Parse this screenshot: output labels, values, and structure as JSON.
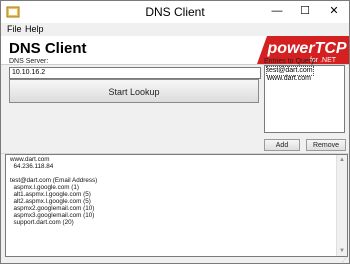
{
  "window": {
    "title": "DNS Client",
    "minimize": "—",
    "maximize": "☐",
    "close": "✕"
  },
  "menu": {
    "file": "File",
    "help": "Help"
  },
  "header": {
    "title": "DNS Client",
    "logo_main": "powerTCP",
    "logo_sub": "for .NET"
  },
  "server": {
    "label": "DNS Server:",
    "value": "10.10.16.2"
  },
  "lookup_button": "Start Lookup",
  "queries": {
    "label": "Entries to Query:",
    "items": [
      "test@dart.com",
      "www.dart.com"
    ]
  },
  "add_button": "Add",
  "remove_button": "Remove",
  "results": [
    "www.dart.com",
    "  64.236.118.84",
    "",
    "test@dart.com (Email Address)",
    "  aspmx.l.google.com (1)",
    "  alt1.aspmx.l.google.com (5)",
    "  alt2.aspmx.l.google.com (5)",
    "  aspmx2.googlemail.com (10)",
    "  aspmx3.googlemail.com (10)",
    "  support.dart.com (20)"
  ],
  "colors": {
    "logo_bg": "#d42020",
    "logo_text": "#ffffff"
  }
}
